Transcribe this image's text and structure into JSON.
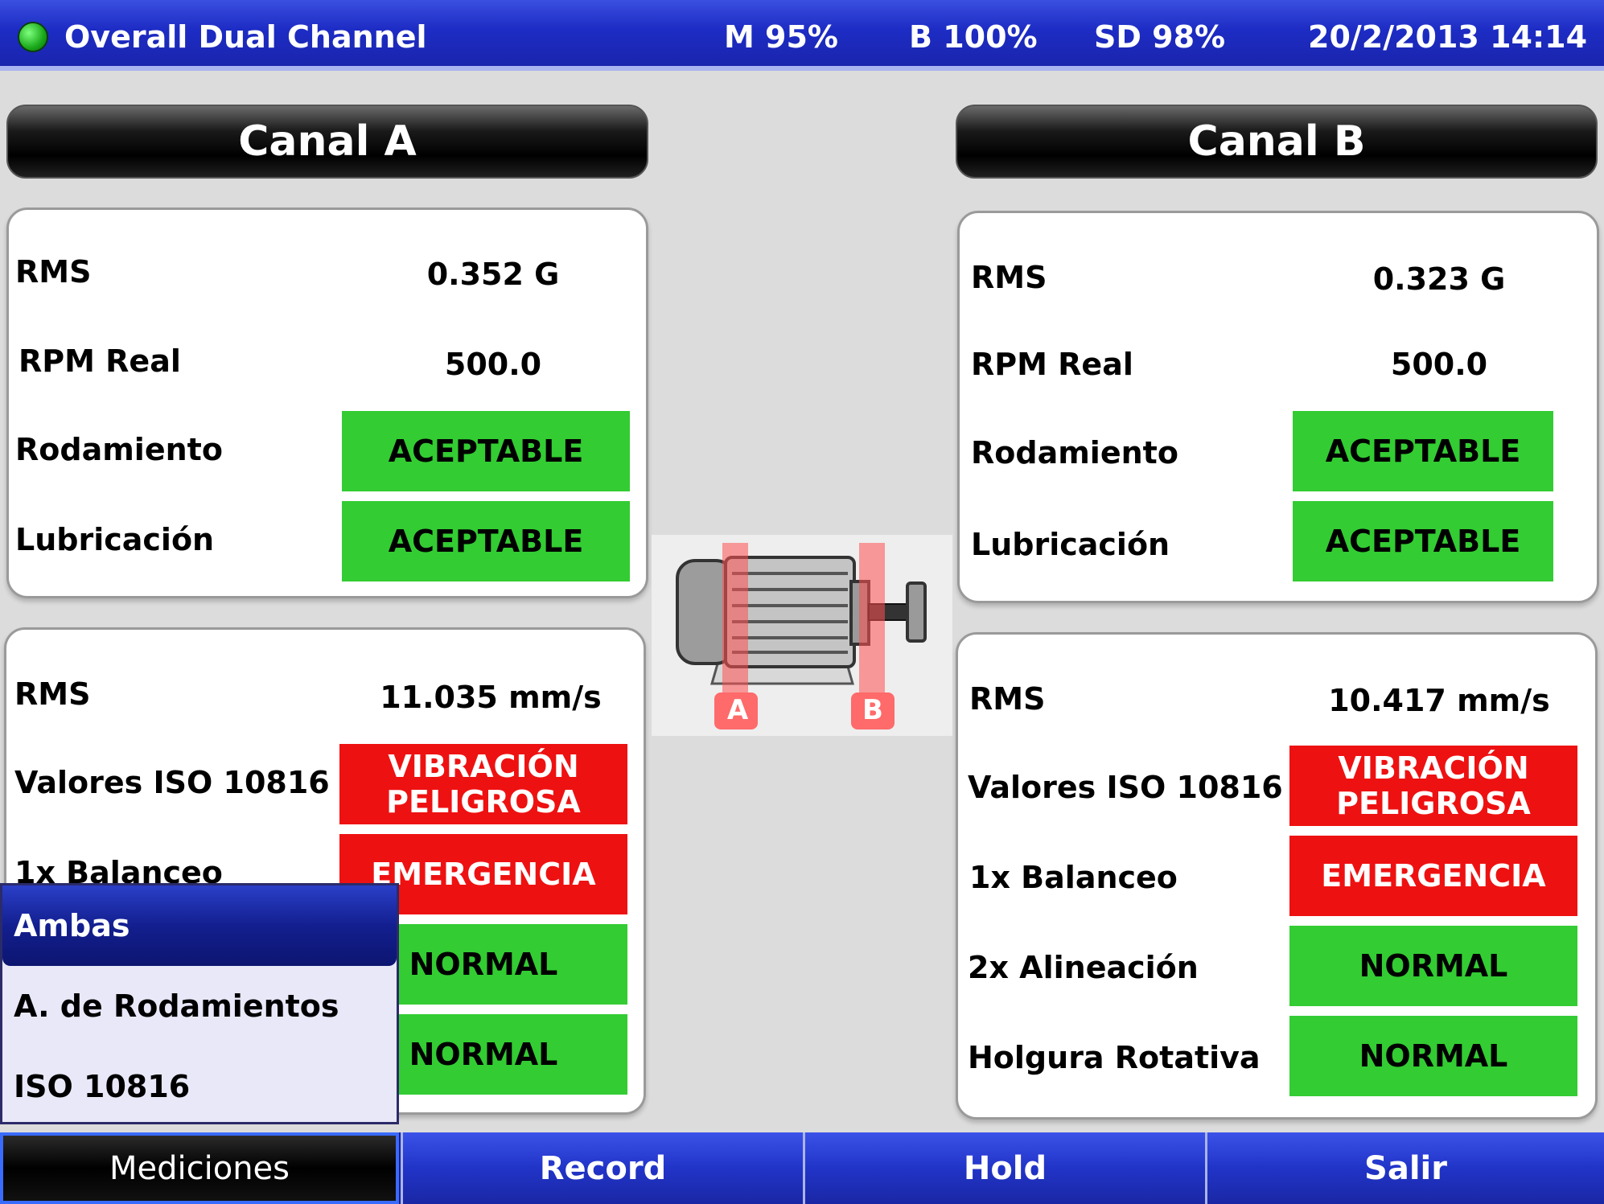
{
  "header": {
    "title": "Overall Dual Channel",
    "status_m": "M 95%",
    "status_b": "B 100%",
    "status_sd": "SD 98%",
    "datetime": "20/2/2013 14:14",
    "led_color": "#22bb22"
  },
  "channel_a": {
    "title": "Canal A",
    "top": {
      "rms_label": "RMS",
      "rms_value": "0.352 G",
      "rpm_label": "RPM Real",
      "rpm_value": "500.0",
      "bearing_label": "Rodamiento",
      "bearing_status": "ACEPTABLE",
      "lube_label": "Lubricación",
      "lube_status": "ACEPTABLE"
    },
    "bottom": {
      "rms_label": "RMS",
      "rms_value": "11.035 mm/s",
      "iso_label": "Valores ISO 10816",
      "iso_status_line1": "VIBRACIÓN",
      "iso_status_line2": "PELIGROSA",
      "balance_label": "1x Balanceo",
      "balance_status": "EMERGENCIA",
      "align_status": "NORMAL",
      "loose_status": "NORMAL"
    }
  },
  "channel_b": {
    "title": "Canal B",
    "top": {
      "rms_label": "RMS",
      "rms_value": "0.323 G",
      "rpm_label": "RPM Real",
      "rpm_value": "500.0",
      "bearing_label": "Rodamiento",
      "bearing_status": "ACEPTABLE",
      "lube_label": "Lubricación",
      "lube_status": "ACEPTABLE"
    },
    "bottom": {
      "rms_label": "RMS",
      "rms_value": "10.417 mm/s",
      "iso_label": "Valores ISO 10816",
      "iso_status_line1": "VIBRACIÓN",
      "iso_status_line2": "PELIGROSA",
      "balance_label": "1x Balanceo",
      "balance_status": "EMERGENCIA",
      "align_label": "2x Alineación",
      "align_status": "NORMAL",
      "loose_label": "Holgura Rotativa",
      "loose_status": "NORMAL"
    }
  },
  "motor": {
    "marker_a": "A",
    "marker_b": "B"
  },
  "menu": {
    "items": [
      {
        "label": "Ambas",
        "selected": true
      },
      {
        "label": "A. de Rodamientos",
        "selected": false
      },
      {
        "label": "ISO 10816",
        "selected": false
      }
    ]
  },
  "toolbar": {
    "measurements": "Mediciones",
    "record": "Record",
    "hold": "Hold",
    "exit": "Salir"
  },
  "colors": {
    "ok": "#33cc33",
    "alarm": "#ee1111",
    "accent": "#2134c8"
  }
}
